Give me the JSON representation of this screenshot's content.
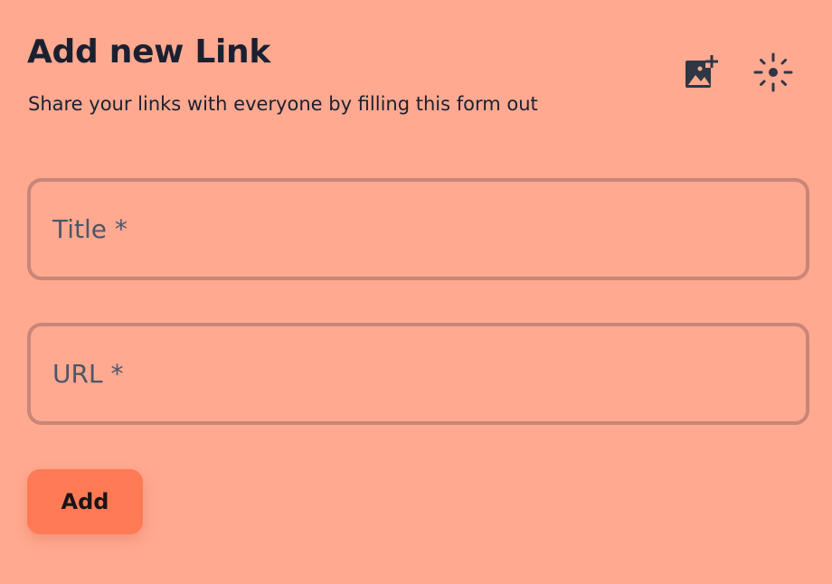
{
  "form": {
    "title": "Add new Link",
    "subtitle": "Share your links with everyone by filling this form out",
    "title_field": {
      "value": "",
      "placeholder": "Title *"
    },
    "url_field": {
      "value": "",
      "placeholder": "URL *"
    },
    "submit_label": "Add"
  },
  "toolbar": {
    "icons": [
      "add-image-icon",
      "sun-icon"
    ]
  },
  "colors": {
    "background": "#ffa990",
    "field_border": "#c88678",
    "button": "#ff7a55",
    "text": "#1b2030",
    "placeholder": "#4d5668"
  }
}
